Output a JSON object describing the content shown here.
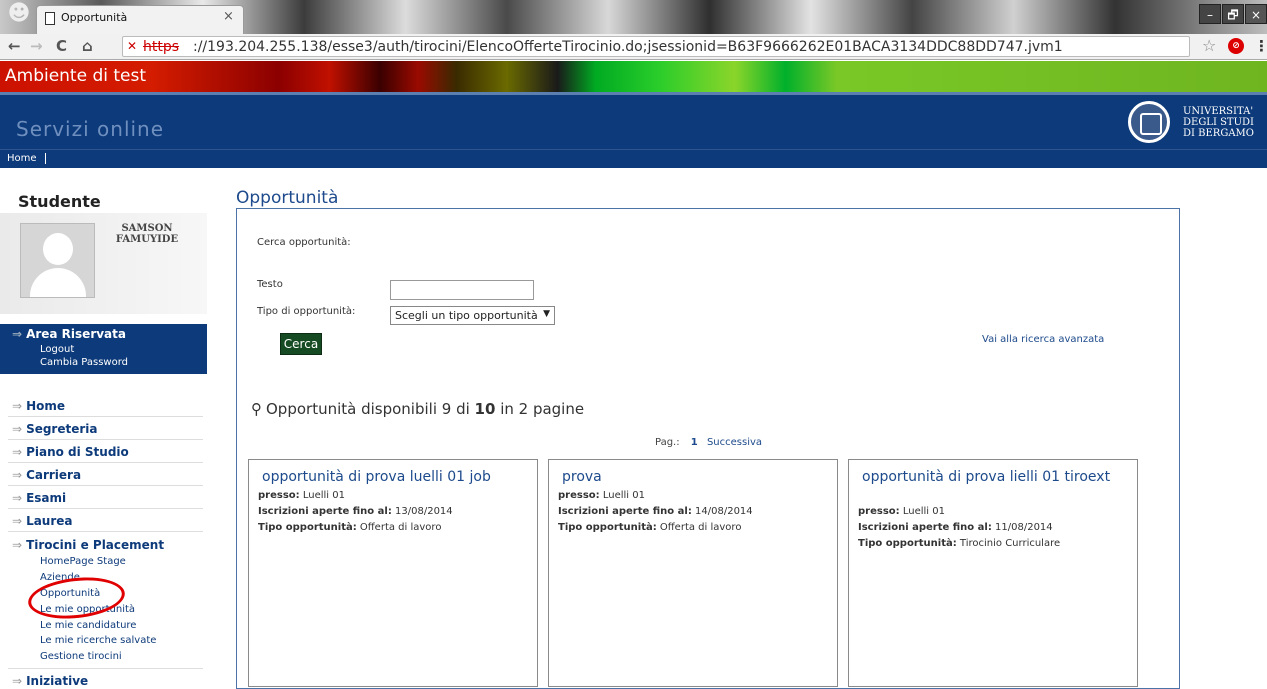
{
  "browser": {
    "tab_title": "Opportunità",
    "tab_close": "×",
    "url_protocol": "https",
    "url_rest": "://193.204.255.138/esse3/auth/tirocini/ElencoOfferteTirocinio.do;jsessionid=B63F9666262E01BACA3134DDC88DD747.jvm1",
    "win_min": "–",
    "win_max": "🗗",
    "win_close": "×",
    "nav_back": "←",
    "nav_fwd": "→",
    "nav_reload": "C",
    "nav_home": "⌂",
    "star": "☆",
    "menu": "⋮"
  },
  "env_banner": "Ambiente di test",
  "header": {
    "site_title": "Servizi online",
    "uni_line1": "UNIVERSITA'",
    "uni_line2": "DEGLI STUDI",
    "uni_line3": "DI BERGAMO"
  },
  "breadcrumb": {
    "home": "Home"
  },
  "sidebar": {
    "role": "Studente",
    "user_first": "SAMSON",
    "user_last": "FAMUYIDE",
    "area": {
      "title": "Area Riservata",
      "logout": "Logout",
      "change_pw": "Cambia Password"
    },
    "menu": [
      {
        "label": "Home"
      },
      {
        "label": "Segreteria"
      },
      {
        "label": "Piano di Studio"
      },
      {
        "label": "Carriera"
      },
      {
        "label": "Esami"
      },
      {
        "label": "Laurea"
      },
      {
        "label": "Tirocini e Placement"
      },
      {
        "label": "Iniziative"
      }
    ],
    "sub": [
      {
        "label": "HomePage Stage"
      },
      {
        "label": "Aziende"
      },
      {
        "label": "Opportunità"
      },
      {
        "label": "Le mie opportunità"
      },
      {
        "label": "Le mie candidature"
      },
      {
        "label": "Le mie ricerche salvate"
      },
      {
        "label": "Gestione tirocini"
      }
    ]
  },
  "main": {
    "title": "Opportunità",
    "search": {
      "heading": "Cerca opportunità:",
      "text_label": "Testo",
      "text_value": "",
      "type_label": "Tipo di opportunità:",
      "type_selected": "Scegli un tipo opportunità",
      "button": "Cerca",
      "advanced": "Vai alla ricerca avanzata"
    },
    "results": {
      "prefix": "Opportunità disponibili 9 di ",
      "total": "10",
      "suffix": " in 2 pagine",
      "pager_label": "Pag.:",
      "pager_current": "1",
      "pager_next": "Successiva"
    },
    "field_labels": {
      "presso": "presso:",
      "iscrizioni": "Iscrizioni aperte fino al:",
      "tipo": "Tipo opportunità:"
    },
    "cards": [
      {
        "title": "opportunità di prova luelli 01 job",
        "presso": "Luelli 01",
        "iscrizioni": "13/08/2014",
        "tipo": "Offerta di lavoro"
      },
      {
        "title": "prova",
        "presso": "Luelli 01",
        "iscrizioni": "14/08/2014",
        "tipo": "Offerta di lavoro"
      },
      {
        "title": "opportunità di prova lielli 01 tiroext",
        "presso": "Luelli 01",
        "iscrizioni": "11/08/2014",
        "tipo": "Tirocinio Curriculare"
      }
    ]
  }
}
